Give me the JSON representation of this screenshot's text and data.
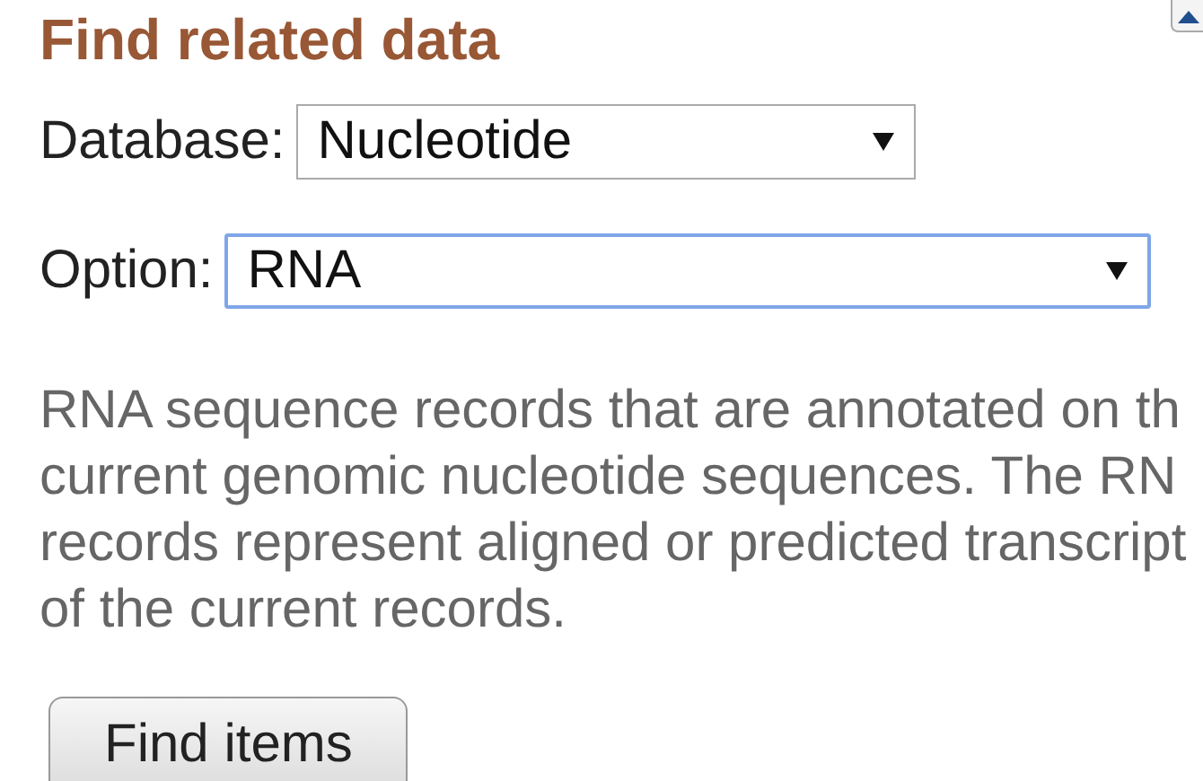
{
  "title": "Find related data",
  "database": {
    "label": "Database:",
    "value": "Nucleotide"
  },
  "option": {
    "label": "Option:",
    "value": "RNA",
    "focused": true
  },
  "description": [
    "RNA sequence records that are annotated on th",
    "current genomic nucleotide sequences. The RN",
    "records represent aligned or predicted transcript",
    "of the current records."
  ],
  "button": "Find items"
}
